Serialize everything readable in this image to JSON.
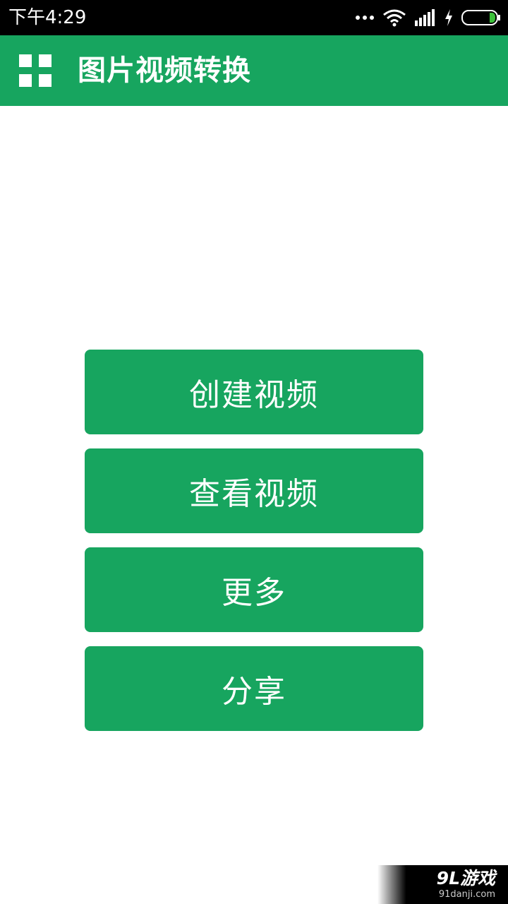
{
  "status_bar": {
    "time": "下午4:29",
    "icons": [
      "more-dots-icon",
      "wifi-icon",
      "signal-icon",
      "charging-bolt-icon",
      "battery-icon"
    ]
  },
  "app_bar": {
    "title": "图片视频转换",
    "menu_icon": "grid-menu-icon"
  },
  "actions": [
    {
      "label": "创建视频"
    },
    {
      "label": "查看视频"
    },
    {
      "label": "更多"
    },
    {
      "label": "分享"
    }
  ],
  "watermark": {
    "logo": "9L游戏",
    "url": "91danji.com"
  },
  "colors": {
    "primary": "#17a55f",
    "status_bar": "#000000",
    "background": "#ffffff",
    "battery_level": "#3cc23a"
  }
}
